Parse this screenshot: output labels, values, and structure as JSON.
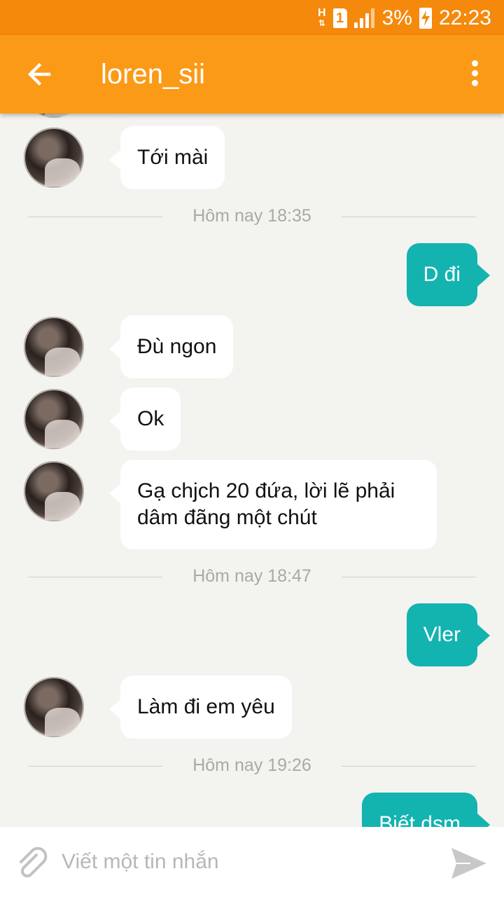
{
  "status_bar": {
    "network": "H",
    "sim": "1",
    "battery": "3%",
    "time": "22:23"
  },
  "app_bar": {
    "title": "loren_sii",
    "icons": [
      "arrow-back-icon",
      "more-vert-icon"
    ]
  },
  "messages": [
    {
      "type": "in",
      "text": "Tới mài"
    },
    {
      "type": "timestamp",
      "text": "Hôm nay 18:35"
    },
    {
      "type": "out",
      "text": "D đi"
    },
    {
      "type": "in",
      "text": "Đù ngon"
    },
    {
      "type": "in",
      "text": "Ok"
    },
    {
      "type": "in",
      "text": "Gạ chjch 20 đứa, lời lẽ phải dâm đãng một chút"
    },
    {
      "type": "timestamp",
      "text": "Hôm nay 18:47"
    },
    {
      "type": "out",
      "text": "Vler"
    },
    {
      "type": "in",
      "text": "Làm đi em yêu"
    },
    {
      "type": "timestamp",
      "text": "Hôm nay 19:26"
    },
    {
      "type": "out",
      "text": "Biết dsm"
    }
  ],
  "composer": {
    "placeholder": "Viết một tin nhắn",
    "icons": [
      "paperclip-icon",
      "send-icon"
    ]
  },
  "colors": {
    "status_bar": "#f5890c",
    "app_bar": "#fb9a17",
    "outgoing_bubble": "#13b3b0",
    "incoming_bubble": "#ffffff",
    "background": "#f3f3ef"
  }
}
